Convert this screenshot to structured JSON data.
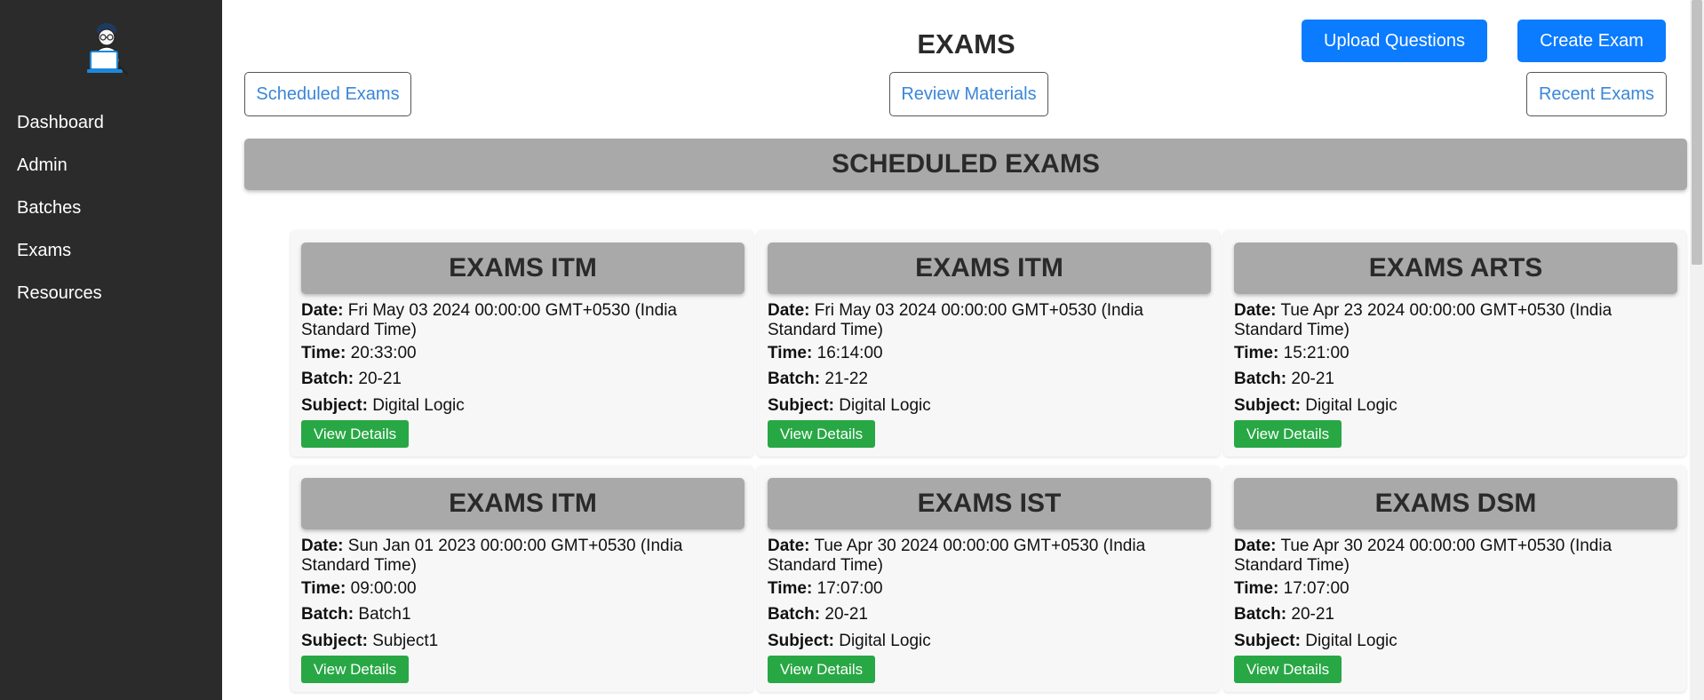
{
  "sidebar": {
    "items": [
      {
        "label": "Dashboard"
      },
      {
        "label": "Admin"
      },
      {
        "label": "Batches"
      },
      {
        "label": "Exams"
      },
      {
        "label": "Resources"
      }
    ]
  },
  "header": {
    "title": "EXAMS",
    "upload_label": "Upload Questions",
    "create_label": "Create Exam"
  },
  "tabs": {
    "scheduled": "Scheduled Exams",
    "review": "Review Materials",
    "recent": "Recent Exams"
  },
  "section_title": "SCHEDULED EXAMS",
  "labels": {
    "date": "Date:",
    "time": "Time:",
    "batch": "Batch:",
    "subject": "Subject:",
    "view_details": "View Details"
  },
  "exams": [
    {
      "title": "EXAMS ITM",
      "date": "Fri May 03 2024 00:00:00 GMT+0530 (India Standard Time)",
      "time": "20:33:00",
      "batch": "20-21",
      "subject": "Digital Logic"
    },
    {
      "title": "EXAMS ITM",
      "date": "Fri May 03 2024 00:00:00 GMT+0530 (India Standard Time)",
      "time": "16:14:00",
      "batch": "21-22",
      "subject": "Digital Logic"
    },
    {
      "title": "EXAMS ARTS",
      "date": "Tue Apr 23 2024 00:00:00 GMT+0530 (India Standard Time)",
      "time": "15:21:00",
      "batch": "20-21",
      "subject": "Digital Logic"
    },
    {
      "title": "EXAMS ITM",
      "date": "Sun Jan 01 2023 00:00:00 GMT+0530 (India Standard Time)",
      "time": "09:00:00",
      "batch": "Batch1",
      "subject": "Subject1"
    },
    {
      "title": "EXAMS IST",
      "date": "Tue Apr 30 2024 00:00:00 GMT+0530 (India Standard Time)",
      "time": "17:07:00",
      "batch": "20-21",
      "subject": "Digital Logic"
    },
    {
      "title": "EXAMS DSM",
      "date": "Tue Apr 30 2024 00:00:00 GMT+0530 (India Standard Time)",
      "time": "17:07:00",
      "batch": "20-21",
      "subject": "Digital Logic"
    }
  ],
  "colors": {
    "sidebar_bg": "#2b2b2b",
    "primary_button": "#0b7bff",
    "success_button": "#28a745",
    "header_gray": "#a9a9a9",
    "link_blue": "#3a86d8"
  },
  "icons": {
    "logo": "student-at-laptop-icon"
  }
}
